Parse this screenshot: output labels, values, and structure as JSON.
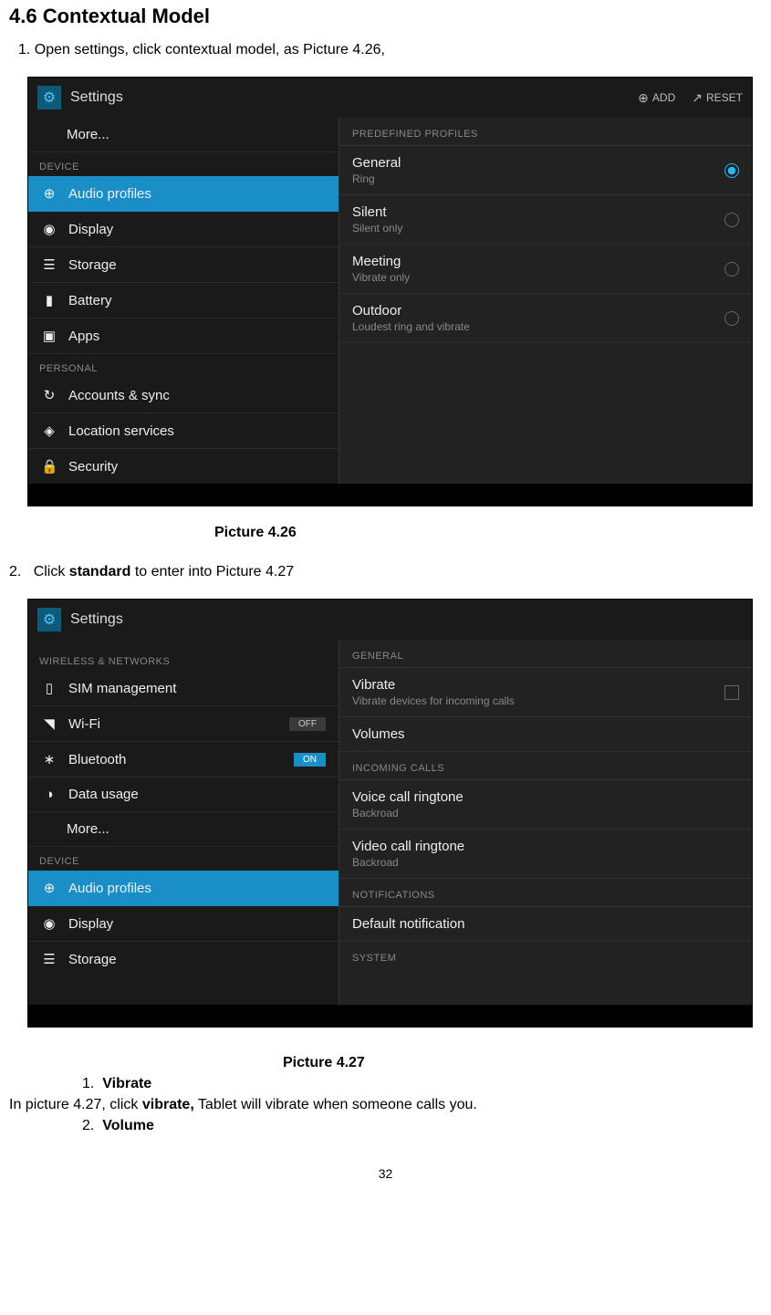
{
  "heading": "4.6 Contextual Model",
  "instruction1": "1. Open settings, click contextual model, as Picture 4.26,",
  "instruction2_num": "2.",
  "instruction2_text_pre": "Click ",
  "instruction2_bold": "standard",
  "instruction2_text_post": " to enter into Picture 4.27",
  "caption1": "Picture 4.26",
  "caption2": "Picture 4.27",
  "sublist": {
    "n1": "1.",
    "item1": "Vibrate",
    "n2": "2.",
    "item2": "Volume"
  },
  "body_pre": "In picture 4.27, click ",
  "body_bold": "vibrate,",
  "body_post": " Tablet will vibrate when someone calls you.",
  "page_num": "32",
  "shot1": {
    "title": "Settings",
    "add": "ADD",
    "reset": "RESET",
    "more": "More...",
    "device": "DEVICE",
    "personal": "PERSONAL",
    "sidebar": {
      "audio": "Audio profiles",
      "display": "Display",
      "storage": "Storage",
      "battery": "Battery",
      "apps": "Apps",
      "accounts": "Accounts & sync",
      "location": "Location services",
      "security": "Security"
    },
    "panel_header": "PREDEFINED PROFILES",
    "profiles": {
      "general": "General",
      "general_sub": "Ring",
      "silent": "Silent",
      "silent_sub": "Silent only",
      "meeting": "Meeting",
      "meeting_sub": "Vibrate only",
      "outdoor": "Outdoor",
      "outdoor_sub": "Loudest ring and vibrate"
    }
  },
  "shot2": {
    "title": "Settings",
    "wireless": "WIRELESS & NETWORKS",
    "device": "DEVICE",
    "sidebar": {
      "sim": "SIM management",
      "wifi": "Wi-Fi",
      "bt": "Bluetooth",
      "data": "Data usage",
      "more": "More...",
      "audio": "Audio profiles",
      "display": "Display",
      "storage": "Storage"
    },
    "off": "OFF",
    "on": "ON",
    "panel": {
      "general": "GENERAL",
      "vibrate": "Vibrate",
      "vibrate_sub": "Vibrate devices for incoming calls",
      "volumes": "Volumes",
      "incoming": "INCOMING CALLS",
      "voice": "Voice call ringtone",
      "voice_sub": "Backroad",
      "video": "Video call ringtone",
      "video_sub": "Backroad",
      "notif": "NOTIFICATIONS",
      "default_notif": "Default notification",
      "system": "SYSTEM"
    }
  }
}
